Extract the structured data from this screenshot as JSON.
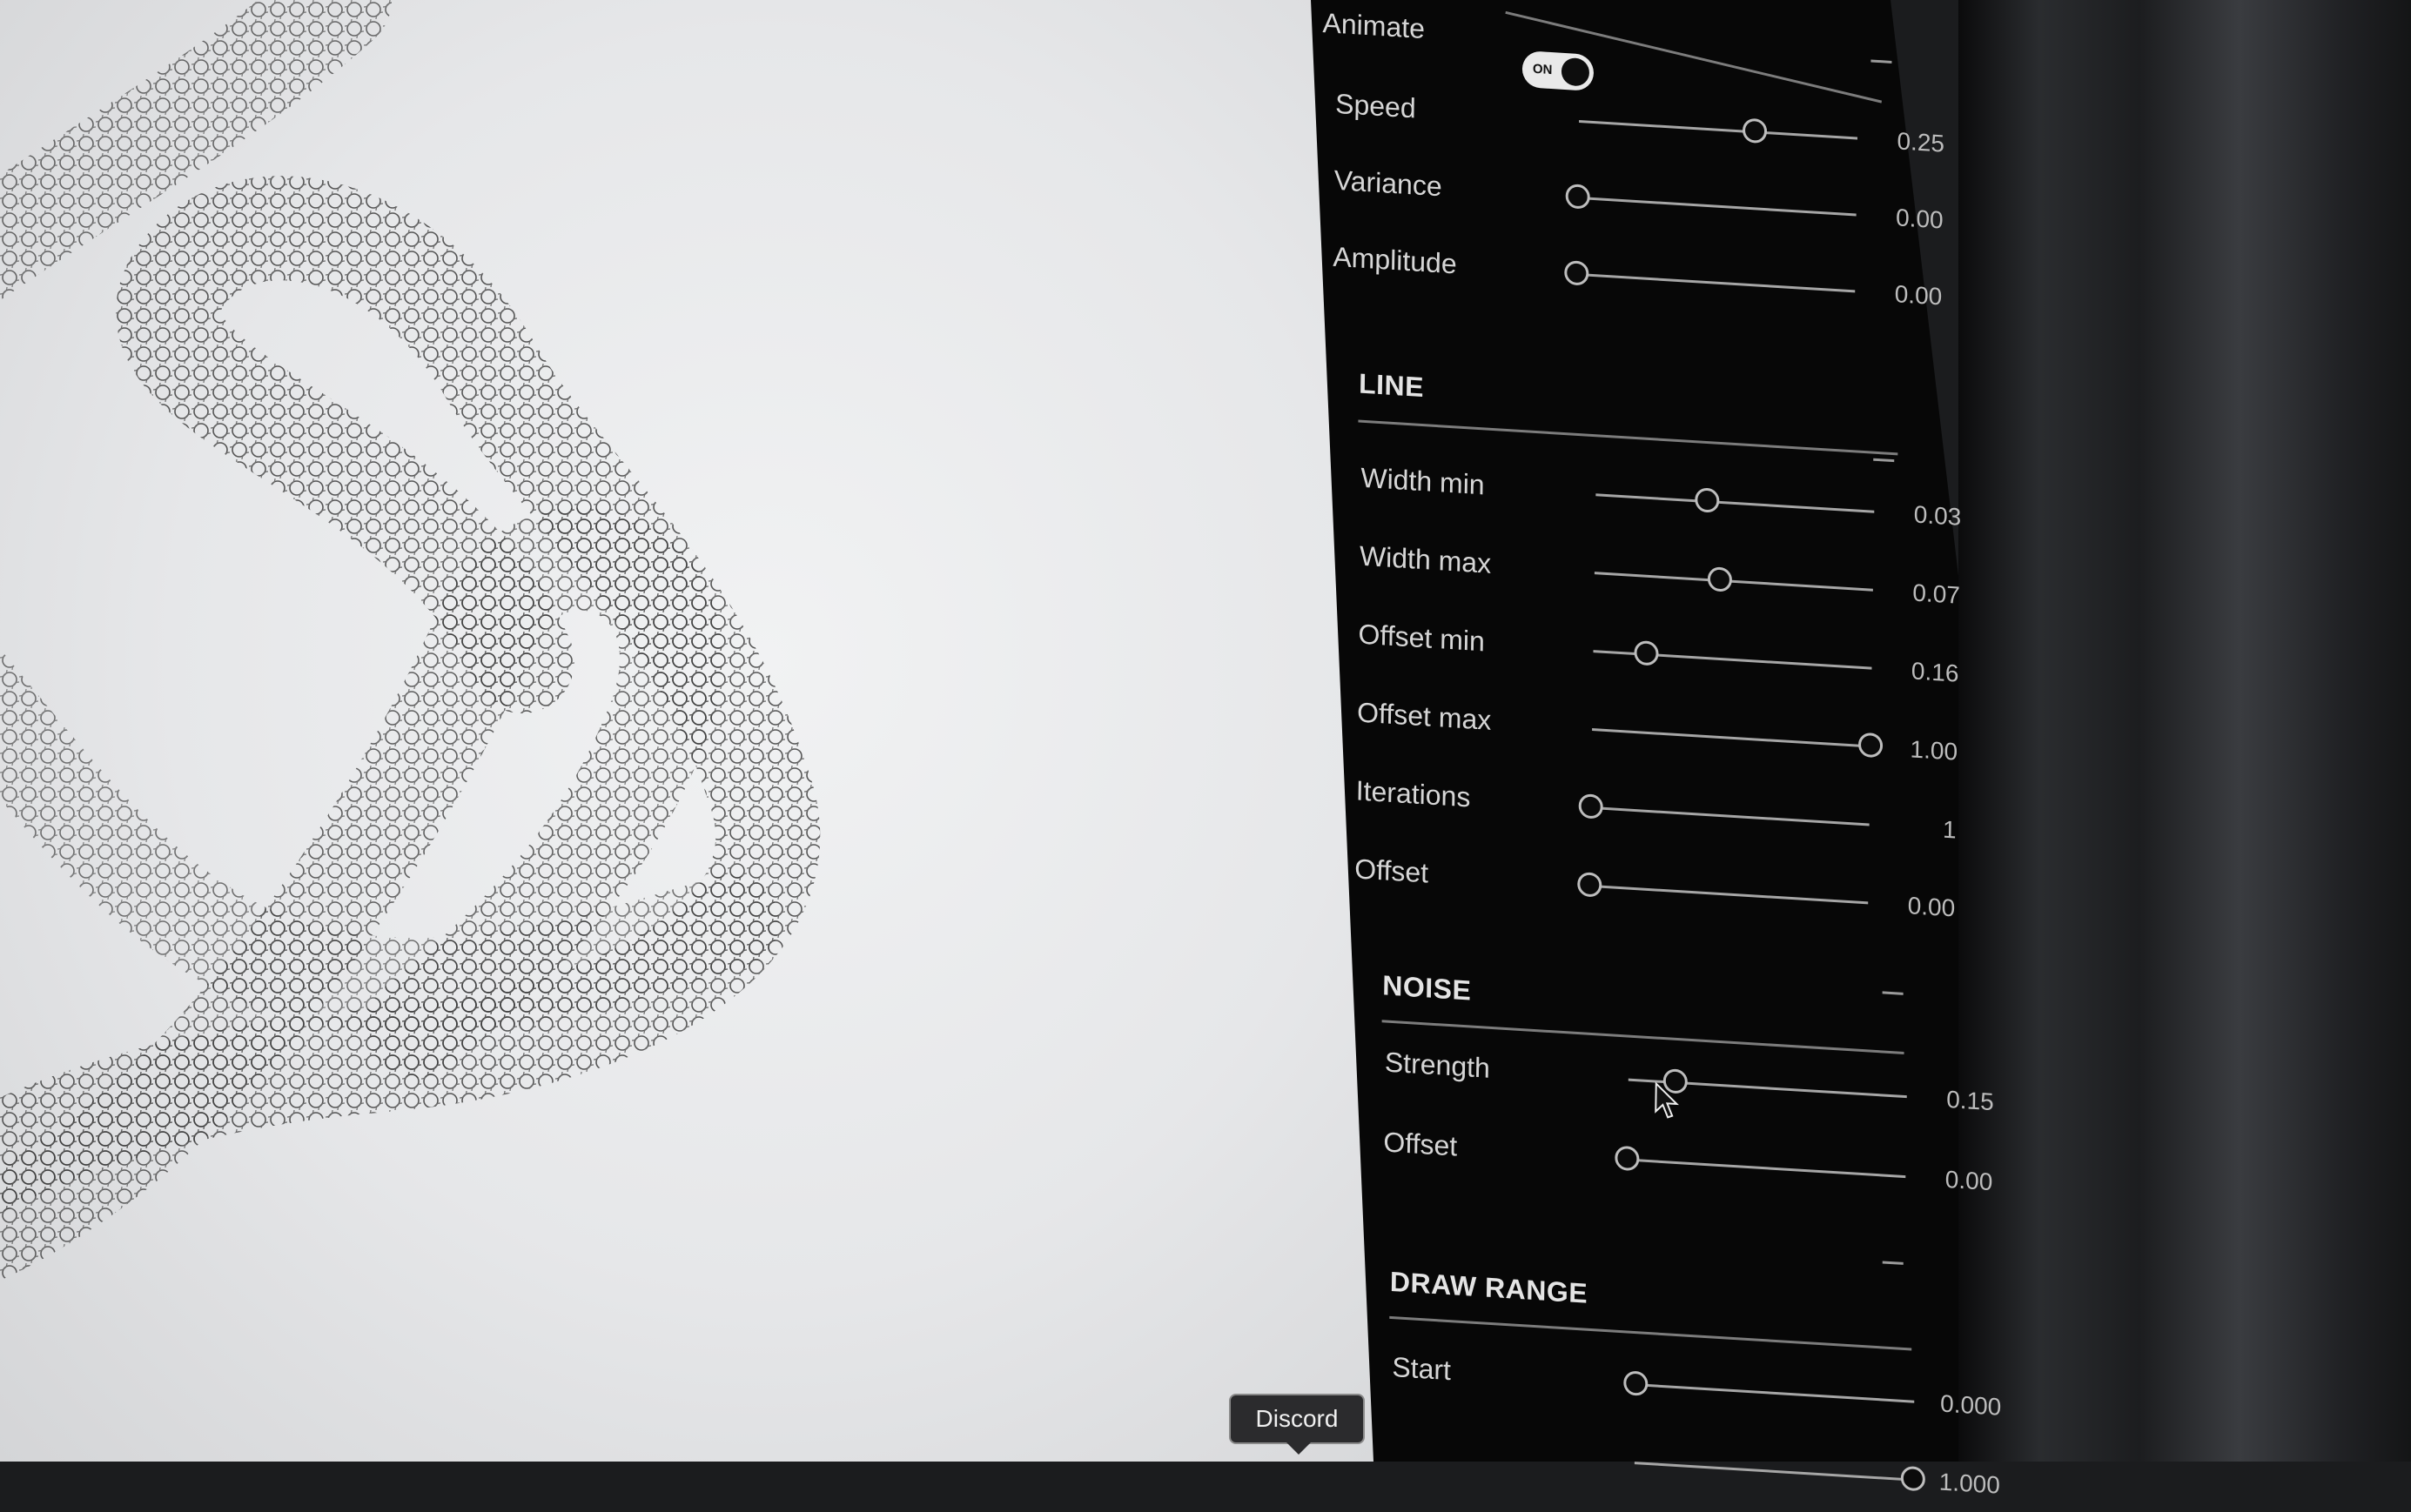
{
  "animation": {
    "animate_label": "Animate",
    "animate_toggle_text": "ON",
    "animate_on": true,
    "rows": [
      {
        "label": "Speed",
        "value": "0.25",
        "fraction": 0.63
      },
      {
        "label": "Variance",
        "value": "0.00",
        "fraction": 0.0
      },
      {
        "label": "Amplitude",
        "value": "0.00",
        "fraction": 0.0
      }
    ]
  },
  "line": {
    "title": "LINE",
    "rows": [
      {
        "label": "Width min",
        "value": "0.03",
        "fraction": 0.4
      },
      {
        "label": "Width max",
        "value": "0.07",
        "fraction": 0.45
      },
      {
        "label": "Offset min",
        "value": "0.16",
        "fraction": 0.19
      },
      {
        "label": "Offset max",
        "value": "1.00",
        "fraction": 1.0
      },
      {
        "label": "Iterations",
        "value": "1",
        "fraction": 0.0
      },
      {
        "label": "Offset",
        "value": "0.00",
        "fraction": 0.0
      }
    ]
  },
  "noise": {
    "title": "NOISE",
    "rows": [
      {
        "label": "Strength",
        "value": "0.15",
        "fraction": 0.17
      },
      {
        "label": "Offset",
        "value": "0.00",
        "fraction": 0.0
      }
    ]
  },
  "draw_range": {
    "title": "DRAW RANGE",
    "rows": [
      {
        "label": "Start",
        "value": "0.000",
        "fraction": 0.0
      },
      {
        "label": "",
        "value": "1.000",
        "fraction": 1.0
      }
    ]
  },
  "tooltip": {
    "text": "Discord"
  },
  "icons": {
    "collapse": "minus-icon",
    "cursor": "mouse-pointer-icon"
  },
  "colors": {
    "panel_bg": "#070707",
    "canvas_bg": "#eeeff0",
    "slider_track": "#a6a6a6",
    "label_text": "#d6d6d6"
  }
}
